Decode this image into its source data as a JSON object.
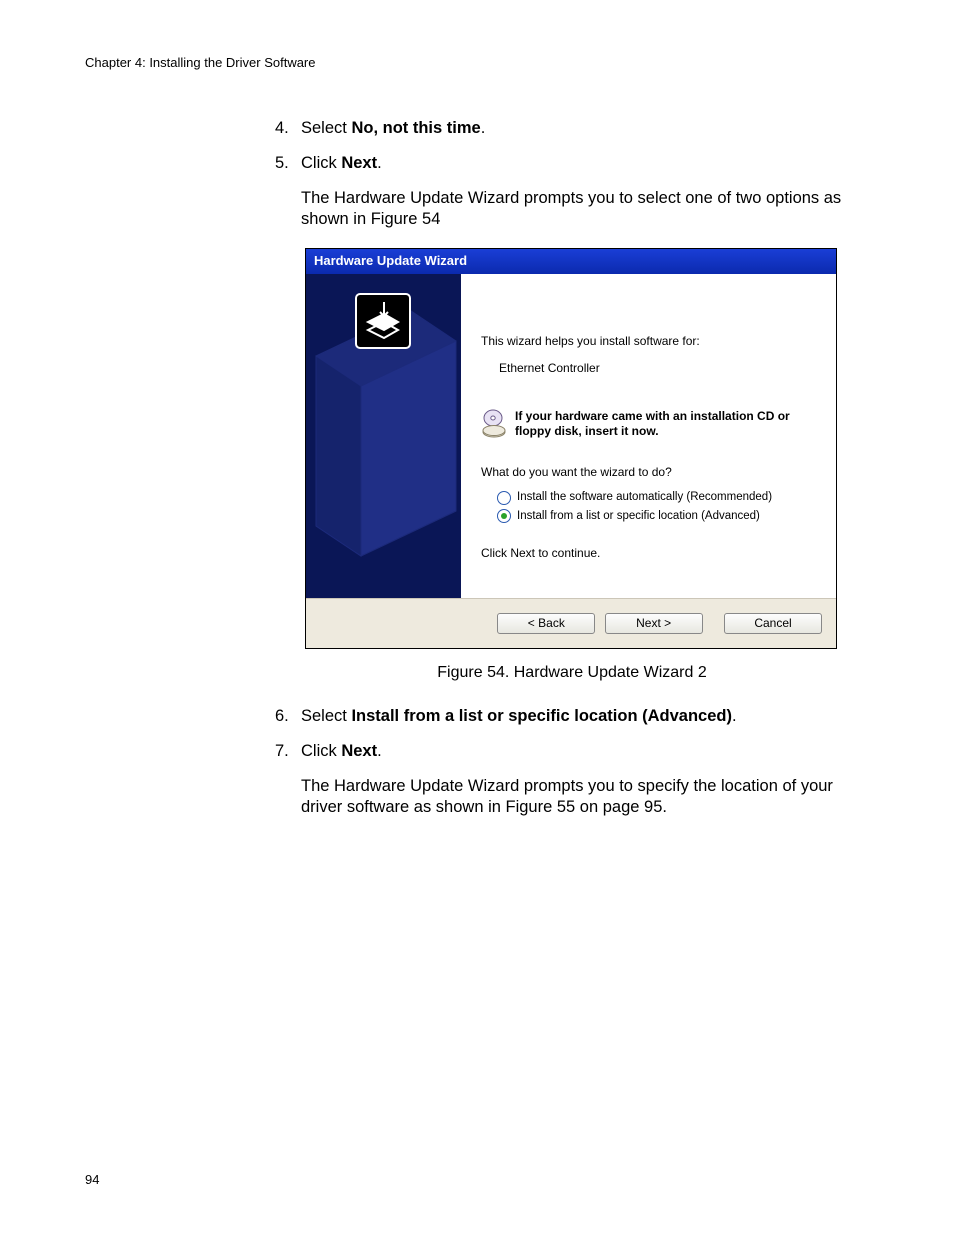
{
  "chapter": "Chapter 4: Installing the Driver Software",
  "list": {
    "i4": {
      "num": "4.",
      "prefix": "Select ",
      "bold": "No, not this time",
      "suffix": "."
    },
    "i5": {
      "num": "5.",
      "prefix": "Click ",
      "bold": "Next",
      "suffix": "."
    },
    "p5a": "The Hardware Update Wizard prompts you to select one of two options as shown in Figure 54",
    "i6": {
      "num": "6.",
      "prefix": "Select ",
      "bold": "Install from a list or specific location (Advanced)",
      "suffix": "."
    },
    "i7": {
      "num": "7.",
      "prefix": "Click ",
      "bold": "Next",
      "suffix": "."
    },
    "p7a": "The Hardware Update Wizard prompts you to specify the location of your driver software as shown in Figure 55 on page 95."
  },
  "figure_caption": "Figure 54. Hardware Update Wizard 2",
  "wizard": {
    "title": "Hardware Update Wizard",
    "intro": "This wizard helps you install software for:",
    "device": "Ethernet Controller",
    "cd_msg": "If your hardware came with an installation CD or floppy disk, insert it now.",
    "question": "What do you want the wizard to do?",
    "opt1": "Install the software automatically (Recommended)",
    "opt2": "Install from a list or specific location (Advanced)",
    "continue": "Click Next to continue.",
    "back": "< Back",
    "next": "Next >",
    "cancel": "Cancel"
  },
  "page_number": "94"
}
